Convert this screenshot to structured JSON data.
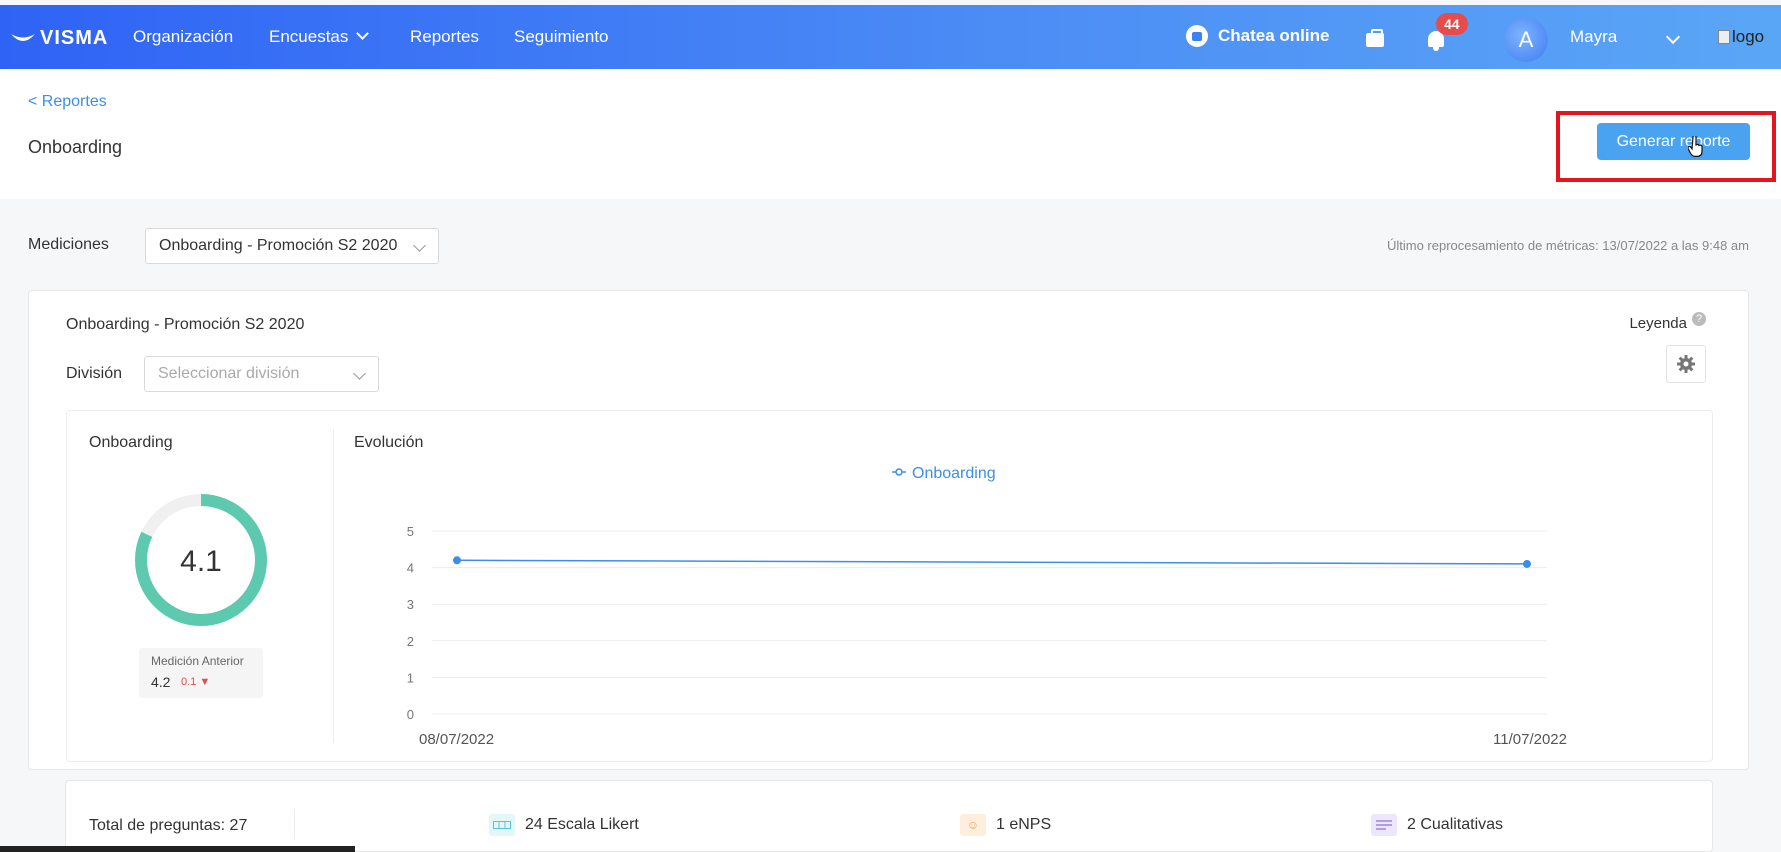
{
  "nav": {
    "brand": "VISMA",
    "links": [
      "Organización",
      "Encuestas",
      "Reportes",
      "Seguimiento"
    ],
    "chat": "Chatea online",
    "notifications": "44",
    "avatar_letter": "A",
    "user": "Mayra",
    "logo_alt": "logo"
  },
  "header": {
    "back": "< Reportes",
    "title": "Onboarding",
    "generate_button": "Generar reporte"
  },
  "filters": {
    "mediciones_label": "Mediciones",
    "mediciones_value": "Onboarding - Promoción S2 2020",
    "reprocess": "Último reprocesamiento de métricas: 13/07/2022 a las 9:48 am"
  },
  "card": {
    "title": "Onboarding - Promoción S2 2020",
    "division_label": "División",
    "division_placeholder": "Seleccionar división",
    "leyenda": "Leyenda",
    "help": "?"
  },
  "gauge": {
    "title": "Onboarding",
    "value": "4.1",
    "fraction": 0.82,
    "previous_label": "Medición Anterior",
    "previous_value": "4.2",
    "previous_delta": "0.1"
  },
  "chart_data": {
    "type": "line",
    "title": "Evolución",
    "legend": "Onboarding",
    "x": [
      "08/07/2022",
      "11/07/2022"
    ],
    "series": [
      {
        "name": "Onboarding",
        "values": [
          4.2,
          4.1
        ]
      }
    ],
    "yticks": [
      0,
      1,
      2,
      3,
      4,
      5
    ],
    "ylim": [
      0,
      5
    ],
    "color": "#3b8fe8"
  },
  "summary": {
    "total": "Total de preguntas: 27",
    "likert": "24 Escala Likert",
    "enps": "1 eNPS",
    "qual": "2 Cualitativas"
  }
}
